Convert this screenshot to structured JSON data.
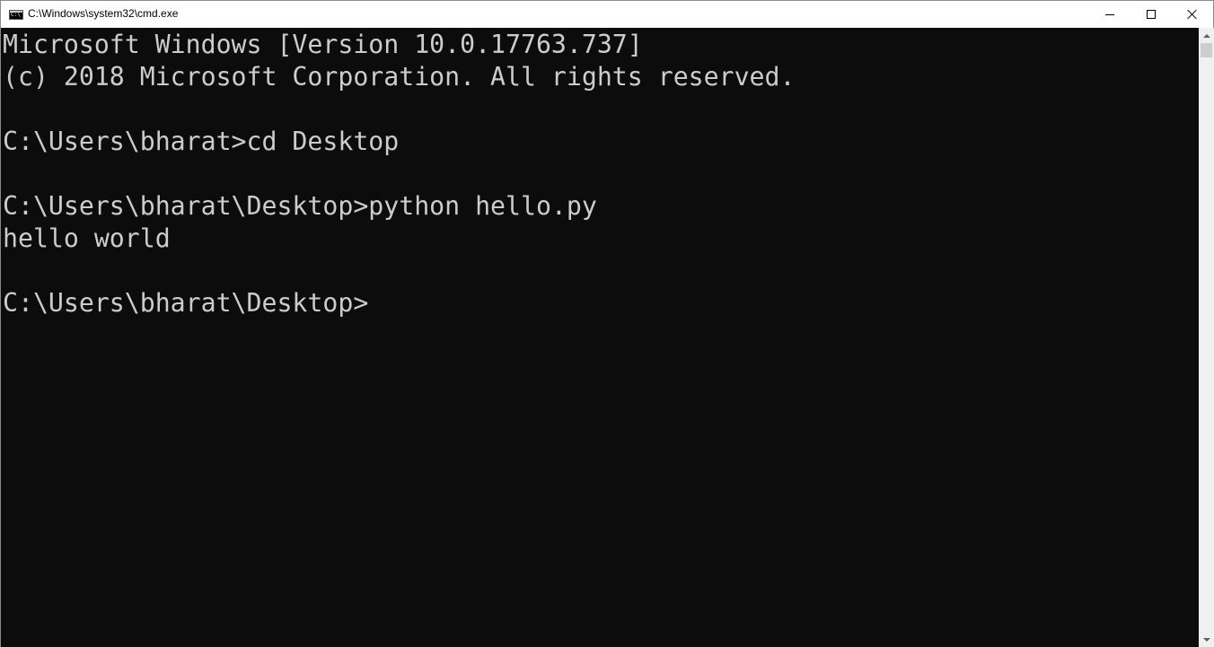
{
  "window": {
    "title": "C:\\Windows\\system32\\cmd.exe",
    "icon": "cmd-icon"
  },
  "caption_buttons": {
    "minimize_icon": "minimize-icon",
    "maximize_icon": "maximize-icon",
    "close_icon": "close-icon"
  },
  "console": {
    "lines": [
      "Microsoft Windows [Version 10.0.17763.737]",
      "(c) 2018 Microsoft Corporation. All rights reserved.",
      "",
      "C:\\Users\\bharat>cd Desktop",
      "",
      "C:\\Users\\bharat\\Desktop>python hello.py",
      "hello world",
      "",
      "C:\\Users\\bharat\\Desktop>"
    ],
    "foreground": "#cccccc",
    "background": "#0c0c0c"
  },
  "scrollbar": {
    "up_icon": "chevron-up-icon",
    "down_icon": "chevron-down-icon"
  }
}
